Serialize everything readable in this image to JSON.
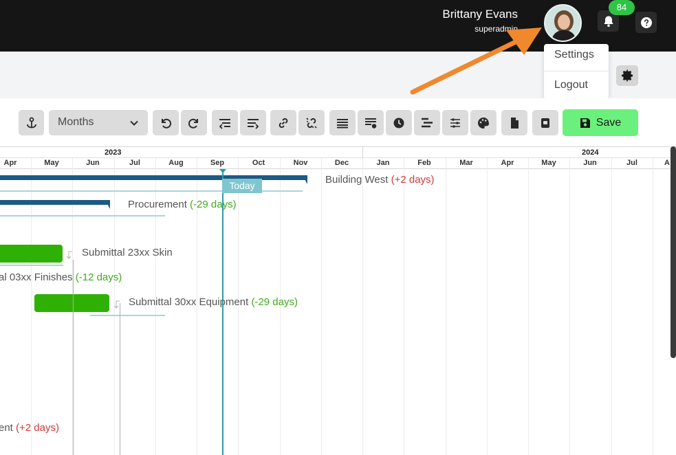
{
  "user": {
    "name": "Brittany Evans",
    "role": "superadmin"
  },
  "notifications": {
    "count": "84"
  },
  "user_menu": {
    "items": [
      "Settings",
      "Logout"
    ]
  },
  "toolbar": {
    "zoom_select": {
      "value": "Months"
    },
    "save_label": "Save"
  },
  "timeline": {
    "years": [
      "2023",
      "2024"
    ],
    "months": [
      "Apr",
      "May",
      "Jun",
      "Jul",
      "Aug",
      "Sep",
      "Oct",
      "Nov",
      "Dec",
      "Jan",
      "Feb",
      "Mar",
      "Apr",
      "May",
      "Jun",
      "Jul",
      "A"
    ],
    "today_label": "Today"
  },
  "tasks": [
    {
      "name": "Building West",
      "delta": "(+2 days)"
    },
    {
      "name": "Procurement",
      "delta": "(-29 days)"
    },
    {
      "name": "Submittal 23xx Skin",
      "delta": ""
    },
    {
      "name": "al 03xx Finishes",
      "delta": "(-12 days)"
    },
    {
      "name": "Submittal 30xx Equipment",
      "delta": "(-29 days)"
    },
    {
      "name": "ent",
      "delta": "(+2 days)"
    }
  ],
  "colors": {
    "save": "#6cf07d",
    "summary_bar": "#1c5a86",
    "task_bar": "#2fb005",
    "today": "#2e9aa6",
    "positive_delay": "#d03a3a",
    "negative_delay": "#42a81f"
  }
}
